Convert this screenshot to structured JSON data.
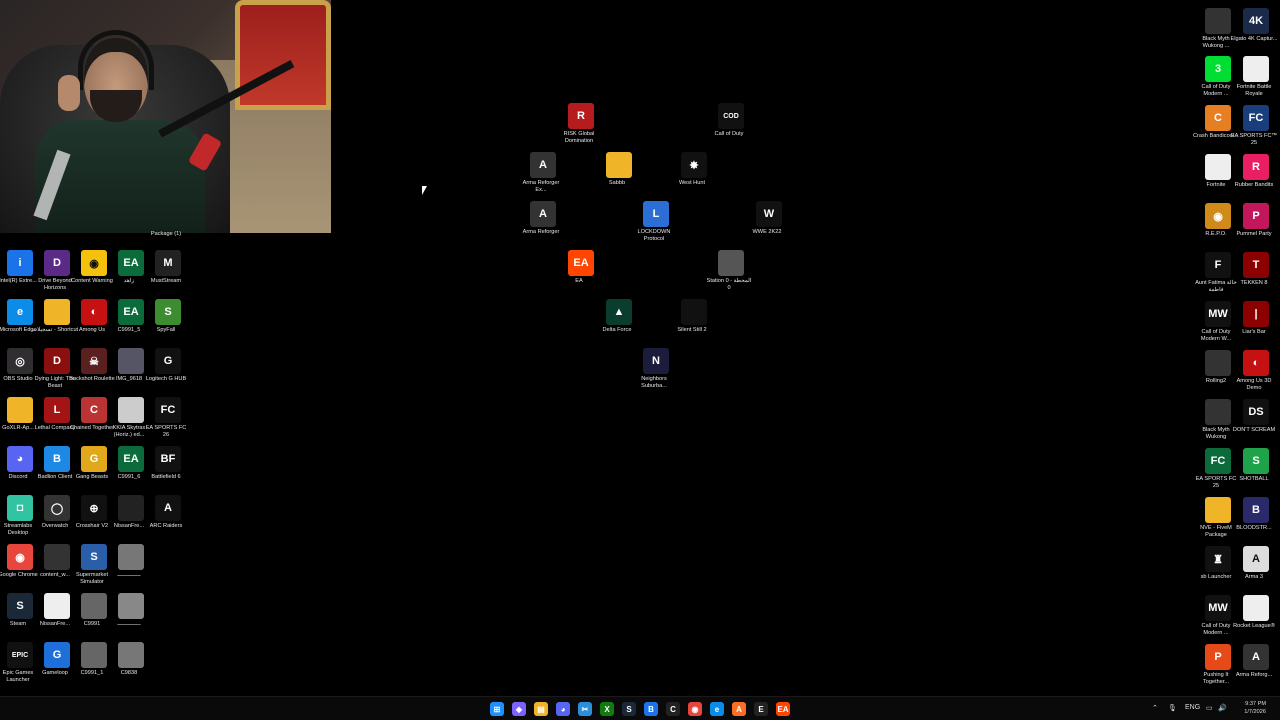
{
  "webcam": {
    "caption": "Package (1)"
  },
  "icons": [
    {
      "id": "intel",
      "label": "Intel(R) Extre...",
      "bg": "#1a73e8",
      "glyph": "i"
    },
    {
      "id": "drive-beyond",
      "label": "Drive Beyond Horizons",
      "bg": "#5b2a86",
      "glyph": "D"
    },
    {
      "id": "content-warning",
      "label": "Content Warning",
      "bg": "#f4c20d",
      "glyph": "◉"
    },
    {
      "id": "ea-1",
      "label": "زاهد",
      "bg": "#0b6b3a",
      "glyph": "EA"
    },
    {
      "id": "muststream",
      "label": "MustStream",
      "bg": "#222",
      "glyph": "M"
    },
    {
      "id": "edge",
      "label": "Microsoft Edge",
      "bg": "#0c8ce9",
      "glyph": "e"
    },
    {
      "id": "folder-shortcut",
      "label": "تسجيلات - Shortcut",
      "bg": "#f0b429",
      "glyph": ""
    },
    {
      "id": "among-us",
      "label": "Among Us",
      "bg": "#c51111",
      "glyph": "◐"
    },
    {
      "id": "c9991-5",
      "label": "C9991_5",
      "bg": "#0b6b3a",
      "glyph": "EA"
    },
    {
      "id": "spyfall",
      "label": "SpyFall",
      "bg": "#3c8d2f",
      "glyph": "S"
    },
    {
      "id": "obs",
      "label": "OBS Studio",
      "bg": "#302e31",
      "glyph": "◎"
    },
    {
      "id": "dbd",
      "label": "Dying Light: The Beast",
      "bg": "#8a1010",
      "glyph": "D"
    },
    {
      "id": "buckshot",
      "label": "Buckshot Roulette",
      "bg": "#5a1f1f",
      "glyph": "☠"
    },
    {
      "id": "img9618",
      "label": "IMG_9618",
      "bg": "#556",
      "glyph": ""
    },
    {
      "id": "logitech",
      "label": "Logitech G HUB",
      "bg": "#111",
      "glyph": "G"
    },
    {
      "id": "goxlr",
      "label": "GoXLR-Ap...",
      "bg": "#f0b429",
      "glyph": ""
    },
    {
      "id": "lethal",
      "label": "Lethal Company",
      "bg": "#a31515",
      "glyph": "L"
    },
    {
      "id": "chained",
      "label": "Chained Together",
      "bg": "#b33",
      "glyph": "C"
    },
    {
      "id": "kkia",
      "label": "KKIA Skytrax (Horiz.) ed...",
      "bg": "#ccc",
      "glyph": ""
    },
    {
      "id": "easports-fc26",
      "label": "EA SPORTS FC 26",
      "bg": "#111",
      "glyph": "FC"
    },
    {
      "id": "discord",
      "label": "Discord",
      "bg": "#5865f2",
      "glyph": "◕"
    },
    {
      "id": "badlion",
      "label": "Badlion Client",
      "bg": "#1e88e5",
      "glyph": "B"
    },
    {
      "id": "gang-beasts",
      "label": "Gang Beasts",
      "bg": "#e0a81a",
      "glyph": "G"
    },
    {
      "id": "c9991-6",
      "label": "C9991_6",
      "bg": "#0b6b3a",
      "glyph": "EA"
    },
    {
      "id": "battlefield6",
      "label": "Battlefield 6",
      "bg": "#111",
      "glyph": "BF"
    },
    {
      "id": "streamlabs",
      "label": "Streamlabs Desktop",
      "bg": "#31c3a2",
      "glyph": "◘"
    },
    {
      "id": "overwatch",
      "label": "Overwatch",
      "bg": "#333",
      "glyph": "◯"
    },
    {
      "id": "crosshair",
      "label": "Crosshair V2",
      "bg": "#111",
      "glyph": "⊕"
    },
    {
      "id": "nissanfre-1",
      "label": "NissanFre...",
      "bg": "#222",
      "glyph": ""
    },
    {
      "id": "arc-raiders",
      "label": "ARC Raiders",
      "bg": "#111",
      "glyph": "A"
    },
    {
      "id": "chrome",
      "label": "Google Chrome",
      "bg": "#e8453c",
      "glyph": "◉"
    },
    {
      "id": "content-w",
      "label": "content_w...",
      "bg": "#333",
      "glyph": ""
    },
    {
      "id": "supermarket",
      "label": "Supermarket Simulator",
      "bg": "#2b5ea8",
      "glyph": "S"
    },
    {
      "id": "arabic-file-1",
      "label": "ــــــــــــــ",
      "bg": "#777",
      "glyph": ""
    },
    {
      "id": "steam",
      "label": "Steam",
      "bg": "#1b2838",
      "glyph": "S"
    },
    {
      "id": "nissanfre-2",
      "label": "NissanFre...",
      "bg": "#eee",
      "glyph": ""
    },
    {
      "id": "c9991",
      "label": "C9991",
      "bg": "#666",
      "glyph": ""
    },
    {
      "id": "arabic-file-2",
      "label": "ــــــــــــــ",
      "bg": "#888",
      "glyph": ""
    },
    {
      "id": "epic",
      "label": "Epic Games Launcher",
      "bg": "#111",
      "glyph": "EPIC"
    },
    {
      "id": "gameloop",
      "label": "Gameloop",
      "bg": "#1e6fd9",
      "glyph": "G"
    },
    {
      "id": "c9991-1",
      "label": "C9991_1",
      "bg": "#666",
      "glyph": ""
    },
    {
      "id": "c9838",
      "label": "C9838",
      "bg": "#777",
      "glyph": ""
    },
    {
      "id": "risk",
      "label": "RISK Global Domination",
      "bg": "#b71c1c",
      "glyph": "R"
    },
    {
      "id": "cod-center",
      "label": "Call of Duty",
      "bg": "#111",
      "glyph": "COD"
    },
    {
      "id": "arma-reforger-ex",
      "label": "Arma Reforger Ex...",
      "bg": "#333",
      "glyph": "A"
    },
    {
      "id": "sabbb",
      "label": "Sabbb",
      "bg": "#f0b429",
      "glyph": ""
    },
    {
      "id": "west-hunt",
      "label": "West Hunt",
      "bg": "#111",
      "glyph": "✸"
    },
    {
      "id": "arma-reforger",
      "label": "Arma Reforger",
      "bg": "#333",
      "glyph": "A"
    },
    {
      "id": "lockdown",
      "label": "LOCKDOWN Protocol",
      "bg": "#2b6fd6",
      "glyph": "L"
    },
    {
      "id": "wwe2k22",
      "label": "WWE 2K22",
      "bg": "#111",
      "glyph": "W"
    },
    {
      "id": "ea-app",
      "label": "EA",
      "bg": "#ff4500",
      "glyph": "EA"
    },
    {
      "id": "station-0",
      "label": "Station 0 - المحطة 0",
      "bg": "#555",
      "glyph": ""
    },
    {
      "id": "delta-force",
      "label": "Delta Force",
      "bg": "#0b3d2e",
      "glyph": "▲"
    },
    {
      "id": "silent-still-2",
      "label": "Silent Still 2",
      "bg": "#111",
      "glyph": ""
    },
    {
      "id": "neighbors",
      "label": "Neighbors Suburba...",
      "bg": "#1c1c3c",
      "glyph": "N"
    },
    {
      "id": "black-myth-1",
      "label": "Black Myth Wukong ...",
      "bg": "#333",
      "glyph": ""
    },
    {
      "id": "elgato",
      "label": "Elgato 4K Captur...",
      "bg": "#1c2a4a",
      "glyph": "4K"
    },
    {
      "id": "cod-mw3",
      "label": "Call of Duty Modern ...",
      "bg": "#0d3",
      "glyph": "3"
    },
    {
      "id": "fortnite-br",
      "label": "Fortnite Battle Royale",
      "bg": "#eee",
      "glyph": ""
    },
    {
      "id": "crash",
      "label": "Crash Bandicoot...",
      "bg": "#e67e22",
      "glyph": "C"
    },
    {
      "id": "easports-fc25-1",
      "label": "EA SPORTS FC™ 25",
      "bg": "#1a3d7c",
      "glyph": "FC"
    },
    {
      "id": "fortnite",
      "label": "Fortnite",
      "bg": "#eee",
      "glyph": ""
    },
    {
      "id": "rubber-bandits",
      "label": "Rubber Bandits",
      "bg": "#e91e63",
      "glyph": "R"
    },
    {
      "id": "repo",
      "label": "R.E.P.O.",
      "bg": "#d08a1a",
      "glyph": "◉"
    },
    {
      "id": "pummel",
      "label": "Pummel Party",
      "bg": "#c2185b",
      "glyph": "P"
    },
    {
      "id": "aunt-fatima",
      "label": "Aunt Fatima خالة فاطمة",
      "bg": "#111",
      "glyph": "F"
    },
    {
      "id": "tekken8",
      "label": "TEKKEN 8",
      "bg": "#8b0000",
      "glyph": "T"
    },
    {
      "id": "cod-mw",
      "label": "Call of Duty Modern W...",
      "bg": "#111",
      "glyph": "MW"
    },
    {
      "id": "liars-bar",
      "label": "Liar's Bar",
      "bg": "#8b0000",
      "glyph": "|"
    },
    {
      "id": "rolling2",
      "label": "Rolling2",
      "bg": "#333",
      "glyph": ""
    },
    {
      "id": "among-us-3d",
      "label": "Among Us 3D Demo",
      "bg": "#c51111",
      "glyph": "◐"
    },
    {
      "id": "black-myth-2",
      "label": "Black Myth Wukong",
      "bg": "#333",
      "glyph": ""
    },
    {
      "id": "dont-scream",
      "label": "DON'T SCREAM",
      "bg": "#111",
      "glyph": "DS"
    },
    {
      "id": "easports-fc25-2",
      "label": "EA SPORTS FC 25",
      "bg": "#0b6b3a",
      "glyph": "FC"
    },
    {
      "id": "shotball",
      "label": "SHOTBALL",
      "bg": "#1fa34a",
      "glyph": "S"
    },
    {
      "id": "nve-fivem",
      "label": "NVE - FiveM Package",
      "bg": "#f0b429",
      "glyph": ""
    },
    {
      "id": "bloodstr",
      "label": "BLOODSTR...",
      "bg": "#2a2a6a",
      "glyph": "B"
    },
    {
      "id": "sb-launcher",
      "label": "sb Launcher",
      "bg": "#111",
      "glyph": "♜"
    },
    {
      "id": "arma3",
      "label": "Arma 3",
      "bg": "#ddd",
      "glyph": "A"
    },
    {
      "id": "cod-mw-2",
      "label": "Call of Duty Modern ...",
      "bg": "#111",
      "glyph": "MW"
    },
    {
      "id": "rocket-league",
      "label": "Rocket League®",
      "bg": "#eee",
      "glyph": ""
    },
    {
      "id": "pushing-it",
      "label": "Pushing It Together...",
      "bg": "#e64a19",
      "glyph": "P"
    },
    {
      "id": "arma-reforger-2",
      "label": "Arma Reforg...",
      "bg": "#333",
      "glyph": "A"
    }
  ],
  "taskbar": {
    "apps": [
      "windows-start-icon",
      "copilot-icon",
      "file-explorer-icon",
      "discord-icon",
      "snipping-tool-icon",
      "xbox-icon",
      "steam-icon",
      "battlenet-icon",
      "capcut-icon",
      "chrome-icon",
      "edge-icon",
      "arc-icon",
      "epic-icon",
      "ea-icon"
    ],
    "tray_lang": "ENG",
    "time": "9:37 PM",
    "date": "1/7/2026"
  }
}
